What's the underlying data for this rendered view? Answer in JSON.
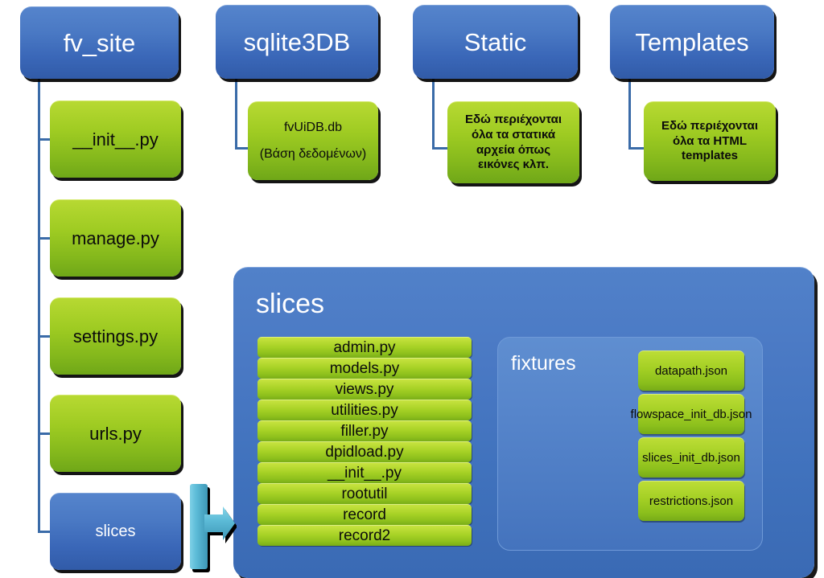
{
  "diagram": {
    "title": "Project directory structure diagram",
    "colors": {
      "folder_blue": "#4a79c4",
      "file_green": "#9ecb22",
      "connector_blue": "#3a6ba8",
      "arrow_cyan": "#5bbcd8",
      "shadow_black": "#000000",
      "folder_text": "#ffffff",
      "file_text": "#0b0b0b"
    },
    "top_folders": [
      {
        "label": "fv_site"
      },
      {
        "label": "sqlite3DB"
      },
      {
        "label": "Static"
      },
      {
        "label": "Templates"
      }
    ],
    "fv_site_children": [
      {
        "label": "__init__.py",
        "type": "file"
      },
      {
        "label": "manage.py",
        "type": "file"
      },
      {
        "label": "settings.py",
        "type": "file"
      },
      {
        "label": "urls.py",
        "type": "file"
      },
      {
        "label": "slices",
        "type": "folder"
      }
    ],
    "sqlite3DB_child": {
      "line1": "fvUiDB.db",
      "line2": "(Βάση δεδομένων)"
    },
    "static_child": {
      "line1": "Εδώ περιέχονται",
      "line2": "όλα τα στατικά",
      "line3": "αρχεία όπως",
      "line4": "εικόνες κλπ."
    },
    "templates_child": {
      "line1": "Εδώ περιέχονται",
      "line2": "όλα τα HTML",
      "line3": "templates"
    },
    "slices_panel": {
      "title": "slices",
      "files": [
        "admin.py",
        "models.py",
        "views.py",
        "utilities.py",
        "filler.py",
        "dpidload.py",
        "__init__.py",
        "rootutil",
        "record",
        "record2"
      ],
      "fixtures": {
        "title": "fixtures",
        "files": [
          "datapath.json",
          "flowspace_init_db.json",
          "slices_init_db.json",
          "restrictions.json"
        ]
      }
    },
    "arrow": {
      "name": "slices-to-panel-arrow",
      "direction": "right"
    }
  }
}
